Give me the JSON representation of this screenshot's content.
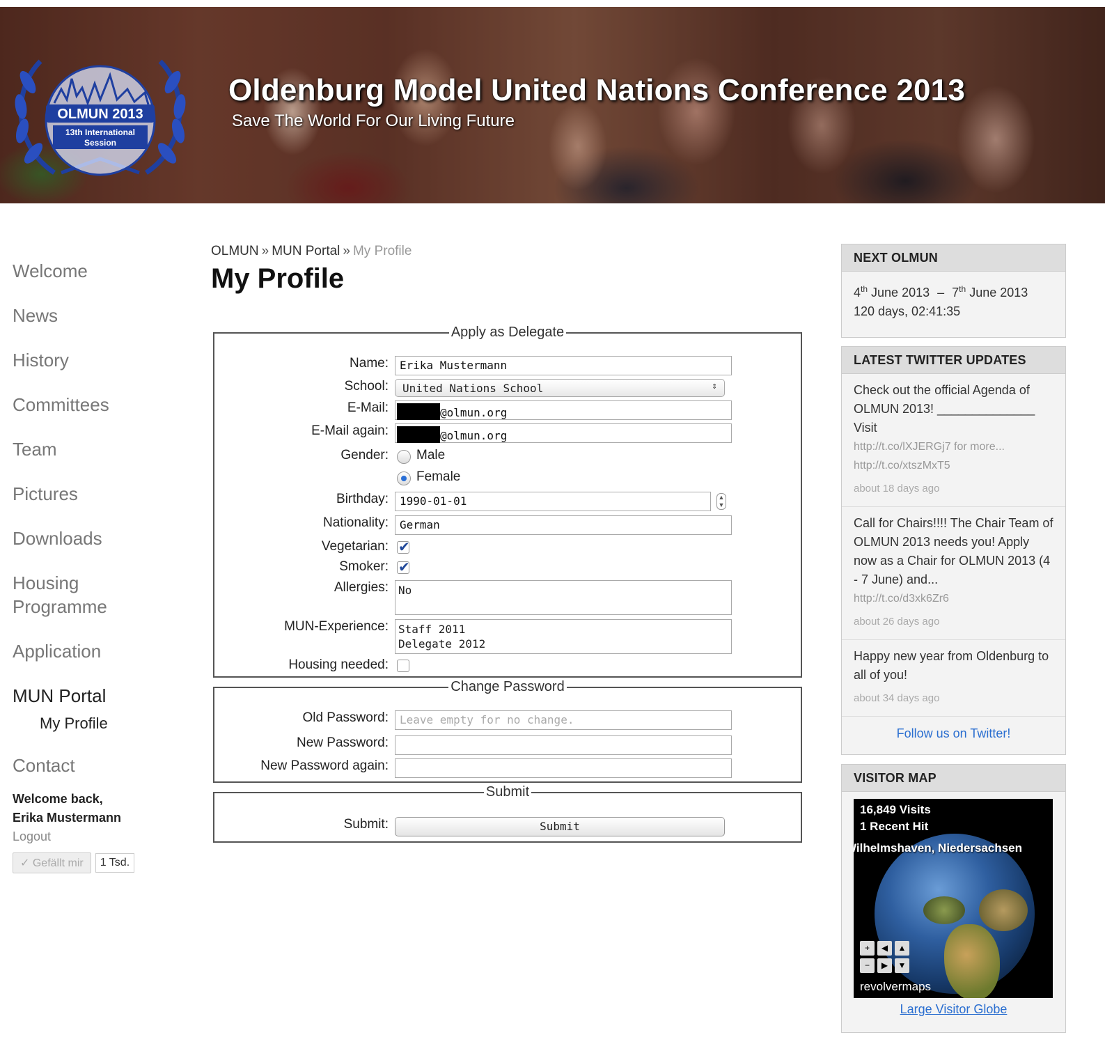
{
  "header": {
    "title": "Oldenburg Model United Nations Conference 2013",
    "subtitle": "Save The World For Our Living Future",
    "logo": {
      "line1": "OLMUN 2013",
      "line2": "13th International",
      "line3": "Session"
    }
  },
  "nav": {
    "items": [
      "Welcome",
      "News",
      "History",
      "Committees",
      "Team",
      "Pictures",
      "Downloads",
      "Housing Programme",
      "Application"
    ],
    "active": "MUN Portal",
    "sub": "My Profile",
    "contact": "Contact",
    "welcome_line1": "Welcome back,",
    "welcome_line2": "Erika Mustermann",
    "logout": "Logout",
    "like_label": "✓ Gefällt mir",
    "like_count": "1 Tsd."
  },
  "breadcrumb": {
    "items": [
      "OLMUN",
      "MUN Portal"
    ],
    "current": "My Profile",
    "sep": "»"
  },
  "page_title": "My Profile",
  "apply": {
    "legend": "Apply as Delegate",
    "name_label": "Name:",
    "name_value": "Erika Mustermann",
    "school_label": "School:",
    "school_value": "United Nations School",
    "email_label": "E-Mail:",
    "email_value": "@olmun.org",
    "email2_label": "E-Mail again:",
    "email2_value": "@olmun.org",
    "gender_label": "Gender:",
    "gender_male": "Male",
    "gender_female": "Female",
    "birthday_label": "Birthday:",
    "birthday_value": "1990-01-01",
    "nationality_label": "Nationality:",
    "nationality_value": "German",
    "vegetarian_label": "Vegetarian:",
    "smoker_label": "Smoker:",
    "allergies_label": "Allergies:",
    "allergies_value": "No",
    "mun_label": "MUN-Experience:",
    "mun_value": "Staff 2011\nDelegate 2012",
    "housing_label": "Housing needed:"
  },
  "password": {
    "legend": "Change Password",
    "old_label": "Old Password:",
    "old_placeholder": "Leave empty for no change.",
    "new_label": "New Password:",
    "new2_label": "New Password again:"
  },
  "submit": {
    "legend": "Submit",
    "label": "Submit:",
    "button": "Submit"
  },
  "sidebar": {
    "next": {
      "title": "NEXT OLMUN",
      "start_day": "4",
      "start_sup": "th",
      "start_rest": " June 2013",
      "dash": "–",
      "end_day": "7",
      "end_sup": "th",
      "end_rest": " June 2013",
      "countdown": "120 days, 02:41:35"
    },
    "twitter": {
      "title": "LATEST TWITTER UPDATES",
      "tweets": [
        {
          "text": "Check out the official Agenda of OLMUN 2013! ______________ Visit",
          "link": "http://t.co/lXJERGj7 for more... http://t.co/xtszMxT5",
          "ago": "about 18 days ago"
        },
        {
          "text": "Call for Chairs!!!! The Chair Team of OLMUN 2013 needs you! Apply now as a Chair for OLMUN 2013 (4 - 7 June) and...",
          "link": "http://t.co/d3xk6Zr6",
          "ago": "about 26 days ago"
        },
        {
          "text": "Happy new year from Oldenburg to all of you!",
          "link": "",
          "ago": "about 34 days ago"
        }
      ],
      "follow": "Follow us on Twitter!"
    },
    "map": {
      "title": "VISITOR MAP",
      "visits": "16,849 Visits",
      "recent": "1 Recent Hit",
      "place": "Wilhelmshaven, Niedersachsen",
      "brand": "revolvermaps",
      "link": "Large Visitor Globe"
    }
  },
  "colors": {
    "link": "#2a6ed0",
    "nav_inactive": "#777777",
    "logo_blue": "#1f3fa0"
  }
}
